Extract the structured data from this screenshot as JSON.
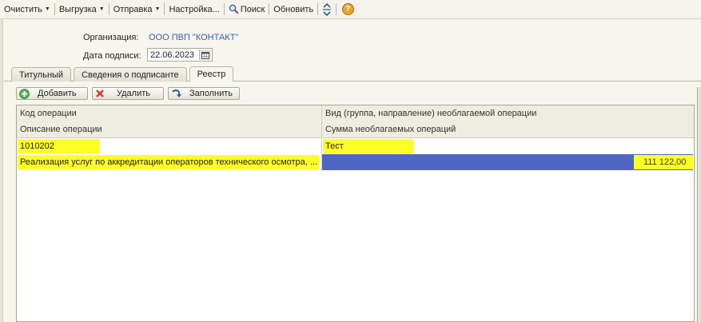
{
  "toolbar": {
    "clear_label": "Очистить",
    "export_label": "Выгрузка",
    "send_label": "Отправка",
    "settings_label": "Настройка...",
    "search_label": "Поиск",
    "refresh_label": "Обновить"
  },
  "form": {
    "org_label": "Организация:",
    "org_value": "ООО ПВП \"КОНТАКТ\"",
    "date_label": "Дата подписи:",
    "date_value": "22.06.2023"
  },
  "tabs": [
    {
      "label": "Титульный"
    },
    {
      "label": "Сведения о подписанте"
    },
    {
      "label": "Реестр",
      "active": true
    }
  ],
  "table_toolbar": {
    "add_label": "Добавить",
    "delete_label": "Удалить",
    "fill_label": "Заполнить"
  },
  "grid": {
    "headers": {
      "op_code": "Код операции",
      "op_kind": "Вид (группа, направление) необлагаемой операции",
      "op_desc": "Описание операции",
      "op_sum": "Сумма необлагаемых операций"
    },
    "rows": [
      {
        "code": "1010202",
        "kind": "Тест",
        "description": "Реализация услуг по аккредитации операторов технического осмотра, ...",
        "sum": "111 122,00"
      }
    ]
  },
  "colors": {
    "highlight": "#fffd26",
    "selection": "#4f67c2",
    "link": "#3b5aa9"
  }
}
